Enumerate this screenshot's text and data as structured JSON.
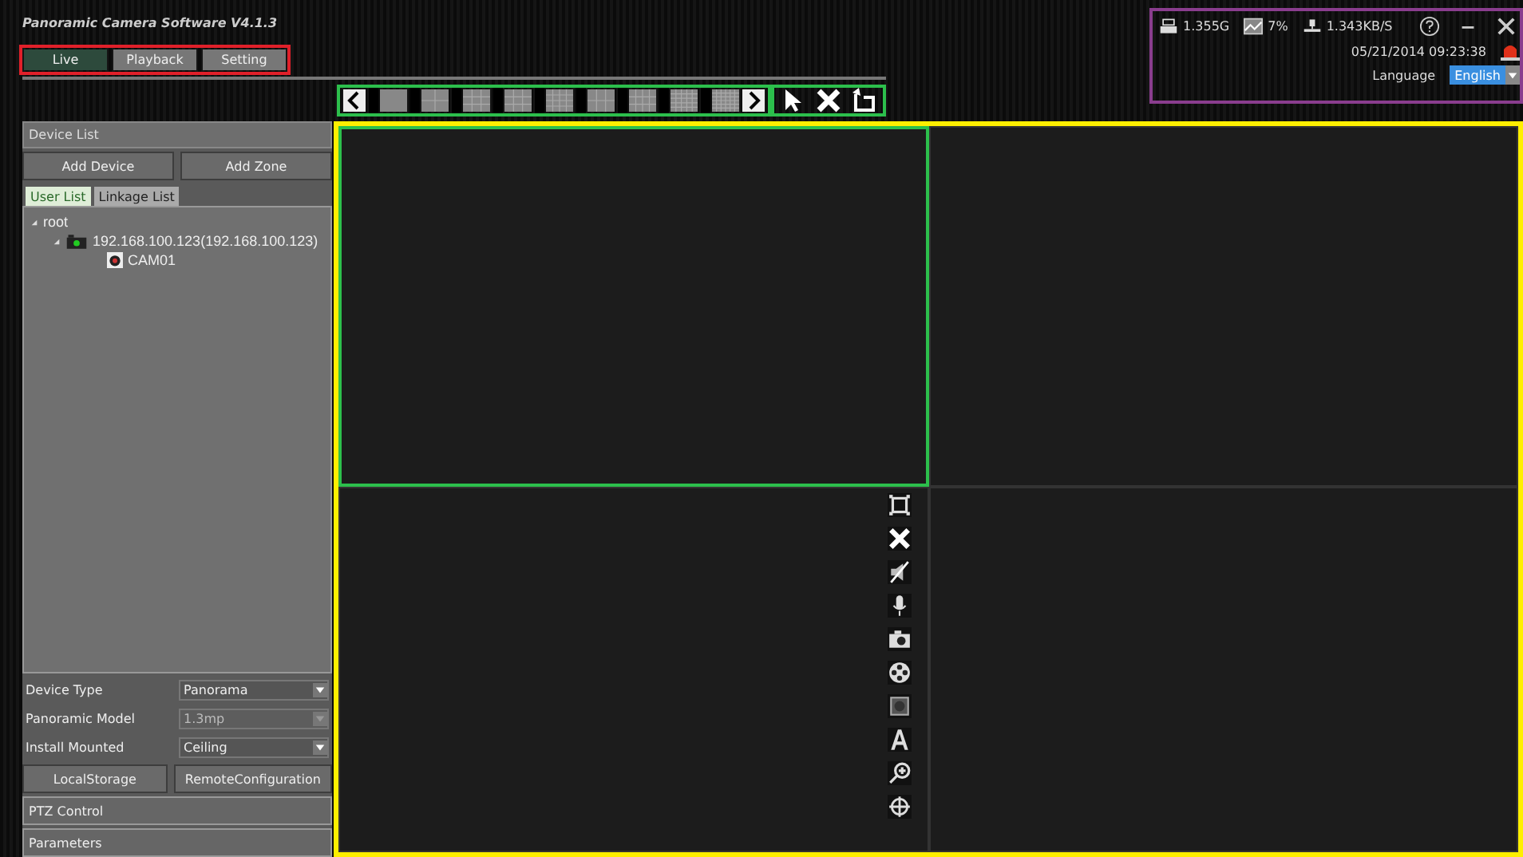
{
  "window": {
    "title": "Panoramic Camera Software V4.1.3"
  },
  "tabs": [
    {
      "label": "Live",
      "selected": true
    },
    {
      "label": "Playback",
      "selected": false
    },
    {
      "label": "Setting",
      "selected": false
    }
  ],
  "status": {
    "disk": "1.355G",
    "cpu": "7%",
    "network": "1.343KB/S",
    "datetime": "05/21/2014 09:23:38",
    "language_label": "Language",
    "language": "English"
  },
  "device_panel": {
    "title": "Device List",
    "buttons": [
      "Add Device",
      "Add Zone"
    ],
    "tabs": [
      {
        "label": "User List",
        "selected": true
      },
      {
        "label": "Linkage List",
        "selected": false
      }
    ],
    "tree": [
      {
        "label": "root",
        "expanded": true,
        "children": [
          {
            "label": "192.168.100.123(192.168.100.123)",
            "kind": "device",
            "expanded": true,
            "children": [
              {
                "label": "CAM01",
                "kind": "camera"
              }
            ]
          }
        ]
      }
    ]
  },
  "settings": [
    {
      "label": "Device Type",
      "value": "Panorama",
      "disabled": false
    },
    {
      "label": "Panoramic Model",
      "value": "1.3mp",
      "disabled": true
    },
    {
      "label": "Install Mounted",
      "value": "Ceiling",
      "disabled": false
    }
  ],
  "storage_buttons": [
    "LocalStorage",
    "RemoteConfiguration"
  ],
  "sections": [
    "PTZ Control",
    "Parameters"
  ],
  "video_cells": [
    {
      "selected": true,
      "show_toolbar": false
    },
    {
      "selected": false,
      "show_toolbar": false
    },
    {
      "selected": false,
      "show_toolbar": true
    },
    {
      "selected": false,
      "show_toolbar": false
    }
  ]
}
